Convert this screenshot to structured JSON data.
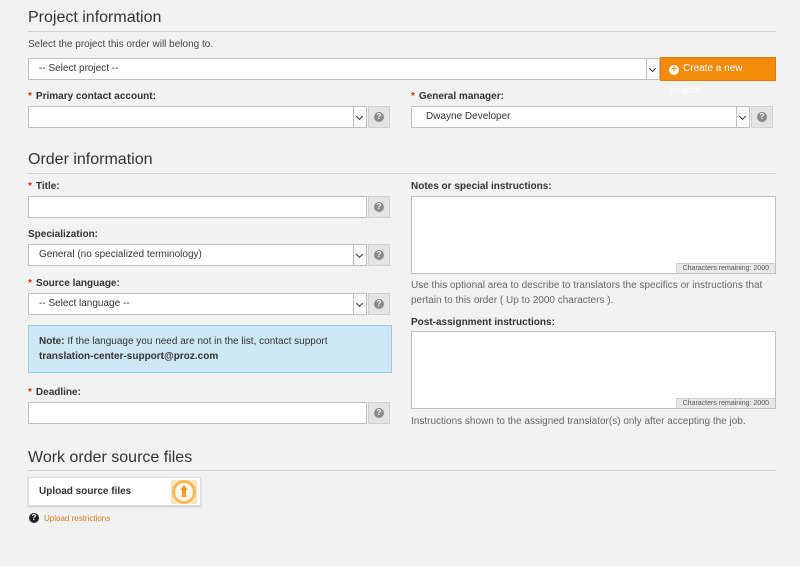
{
  "project_info": {
    "heading": "Project information",
    "intro": "Select the project this order will belong to.",
    "project_select_value": "-- Select project --",
    "create_project_label": "Create a new project",
    "primary_contact_label": "Primary contact account:",
    "primary_contact_value": "",
    "general_manager_label": "General manager:",
    "general_manager_value": "Dwayne Developer",
    "required_mark": "*"
  },
  "order_info": {
    "heading": "Order information",
    "title_label": "Title:",
    "title_value": "",
    "specialization_label": "Specialization:",
    "specialization_value": "General (no specialized terminology)",
    "source_language_label": "Source language:",
    "source_language_value": "-- Select language --",
    "note_prefix": "Note:",
    "note_text": " If the language you need are not in the list, contact support ",
    "note_email": "translation-center-support@proz.com",
    "deadline_label": "Deadline:",
    "deadline_value": "",
    "notes_label": "Notes or special instructions:",
    "notes_counter": "Characters remaining: 2000",
    "notes_help": "Use this optional area to describe to translators the specifics or instructions that pertain to this order ( Up to 2000 characters ).",
    "post_label": "Post-assignment instructions:",
    "post_counter": "Characters remaining: 2000",
    "post_help": "Instructions shown to the assigned translator(s) only after accepting the job."
  },
  "source_files": {
    "heading": "Work order source files",
    "upload_label": "Upload source files",
    "restrictions_link": "Upload restrictions"
  },
  "icons": {
    "help": "question-mark-icon",
    "select_arrow": "chevron-down-icon",
    "plus": "plus-circle-icon",
    "upload": "upload-arrow-icon"
  },
  "colors": {
    "accent": "#f28a0a",
    "required": "#cc3300",
    "note_bg": "#cde7f5",
    "link": "#d9791b"
  }
}
